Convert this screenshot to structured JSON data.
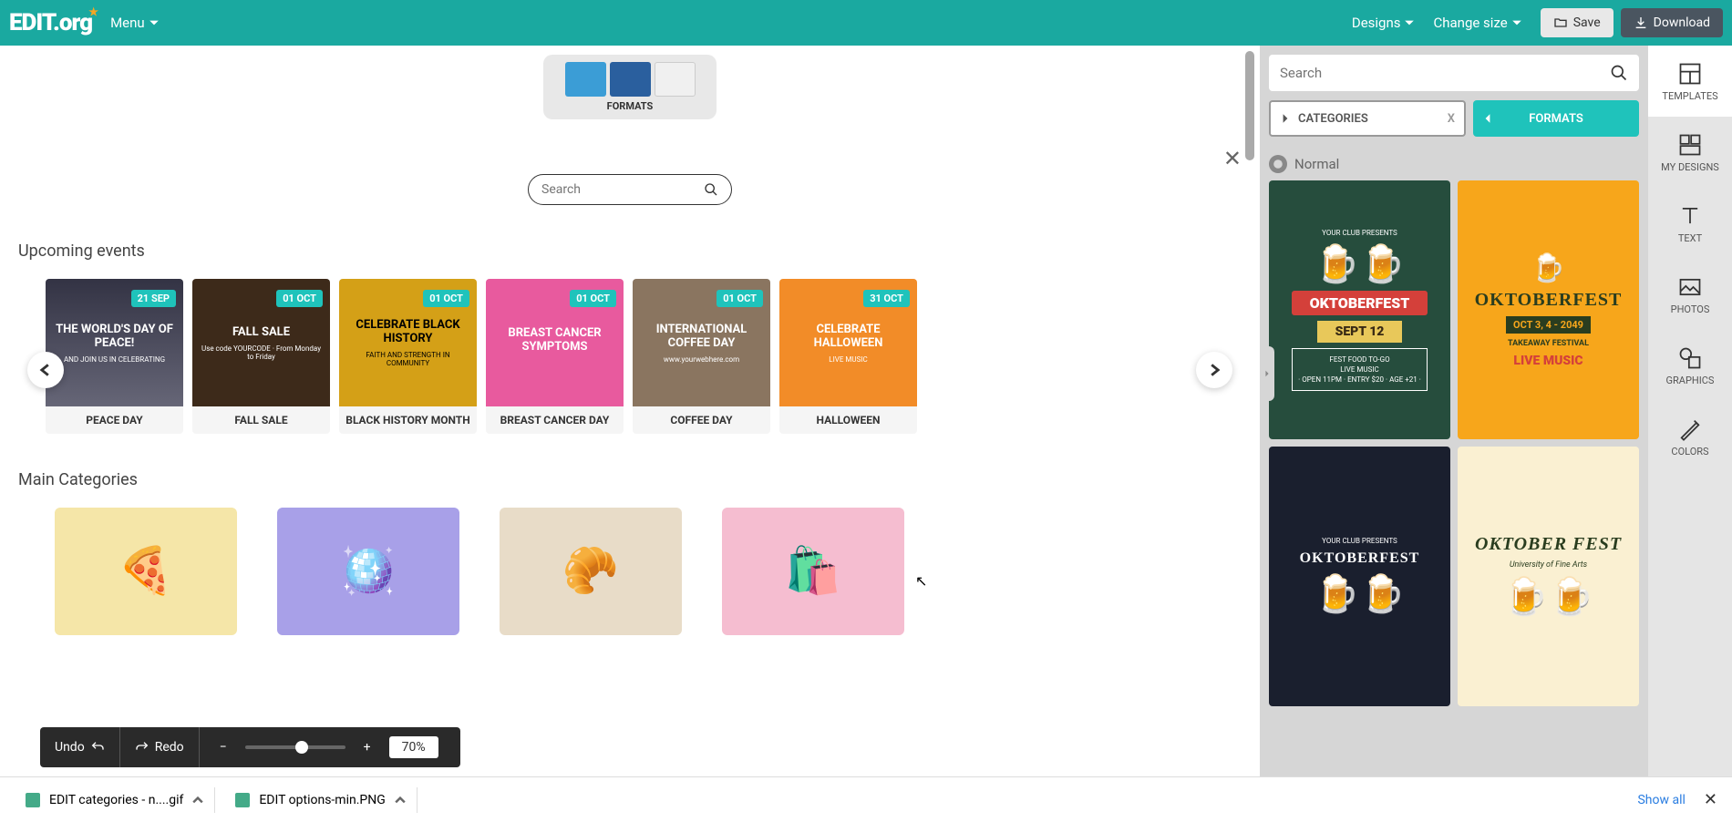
{
  "topbar": {
    "logo": "EDIT.org",
    "menu": "Menu",
    "designs": "Designs",
    "change_size": "Change size",
    "save": "Save",
    "download": "Download"
  },
  "rail": {
    "templates": "TEMPLATES",
    "my_designs": "MY DESIGNS",
    "text": "TEXT",
    "photos": "PHOTOS",
    "graphics": "GRAPHICS",
    "colors": "COLORS"
  },
  "panel": {
    "search_placeholder": "Search",
    "categories": "CATEGORIES",
    "categories_x": "X",
    "formats": "FORMATS",
    "normal": "Normal",
    "tpl1": {
      "presents": "YOUR CLUB PRESENTS",
      "name": "OKTOBERFEST",
      "date": "SEPT 12",
      "l1": "FEST FOOD TO-GO",
      "l2": "LIVE MUSIC",
      "l3": "· OPEN 11PM · ENTRY $20 · AGE +21 ·"
    },
    "tpl2": {
      "name": "OKTOBERFEST",
      "date": "OCT 3, 4 - 2049",
      "sub": "TAKEAWAY FESTIVAL",
      "live": "LIVE MUSIC"
    },
    "tpl3": {
      "presents": "YOUR CLUB PRESENTS",
      "name": "OKTOBERFEST"
    },
    "tpl4": {
      "name": "OKTOBER FEST",
      "sub": "University of Fine Arts"
    }
  },
  "modal": {
    "formats_label": "FORMATS",
    "search_placeholder": "Search",
    "upcoming": "Upcoming events",
    "main_categories": "Main Categories"
  },
  "events": [
    {
      "date": "21 SEP",
      "title": "PEACE DAY",
      "line1": "THE WORLD'S DAY OF PEACE!",
      "line2": "AND JOIN US IN CELEBRATING"
    },
    {
      "date": "01 OCT",
      "title": "FALL SALE",
      "line1": "FALL SALE",
      "line2": "Use code YOURCODE · From Monday to Friday"
    },
    {
      "date": "01 OCT",
      "title": "BLACK HISTORY MONTH",
      "line1": "CELEBRATE BLACK HISTORY",
      "line2": "FAITH AND STRENGTH IN COMMUNITY"
    },
    {
      "date": "01 OCT",
      "title": "BREAST CANCER DAY",
      "line1": "BREAST CANCER SYMPTOMS",
      "line2": ""
    },
    {
      "date": "01 OCT",
      "title": "COFFEE DAY",
      "line1": "INTERNATIONAL COFFEE DAY",
      "line2": "www.yourwebhere.com"
    },
    {
      "date": "31 OCT",
      "title": "HALLOWEEN",
      "line1": "CELEBRATE HALLOWEEN",
      "line2": "LIVE MUSIC"
    }
  ],
  "bottom": {
    "undo": "Undo",
    "redo": "Redo",
    "zoom": "70%"
  },
  "shelf": {
    "file1": "EDIT categories - n....gif",
    "file2": "EDIT options-min.PNG",
    "show_all": "Show all"
  }
}
